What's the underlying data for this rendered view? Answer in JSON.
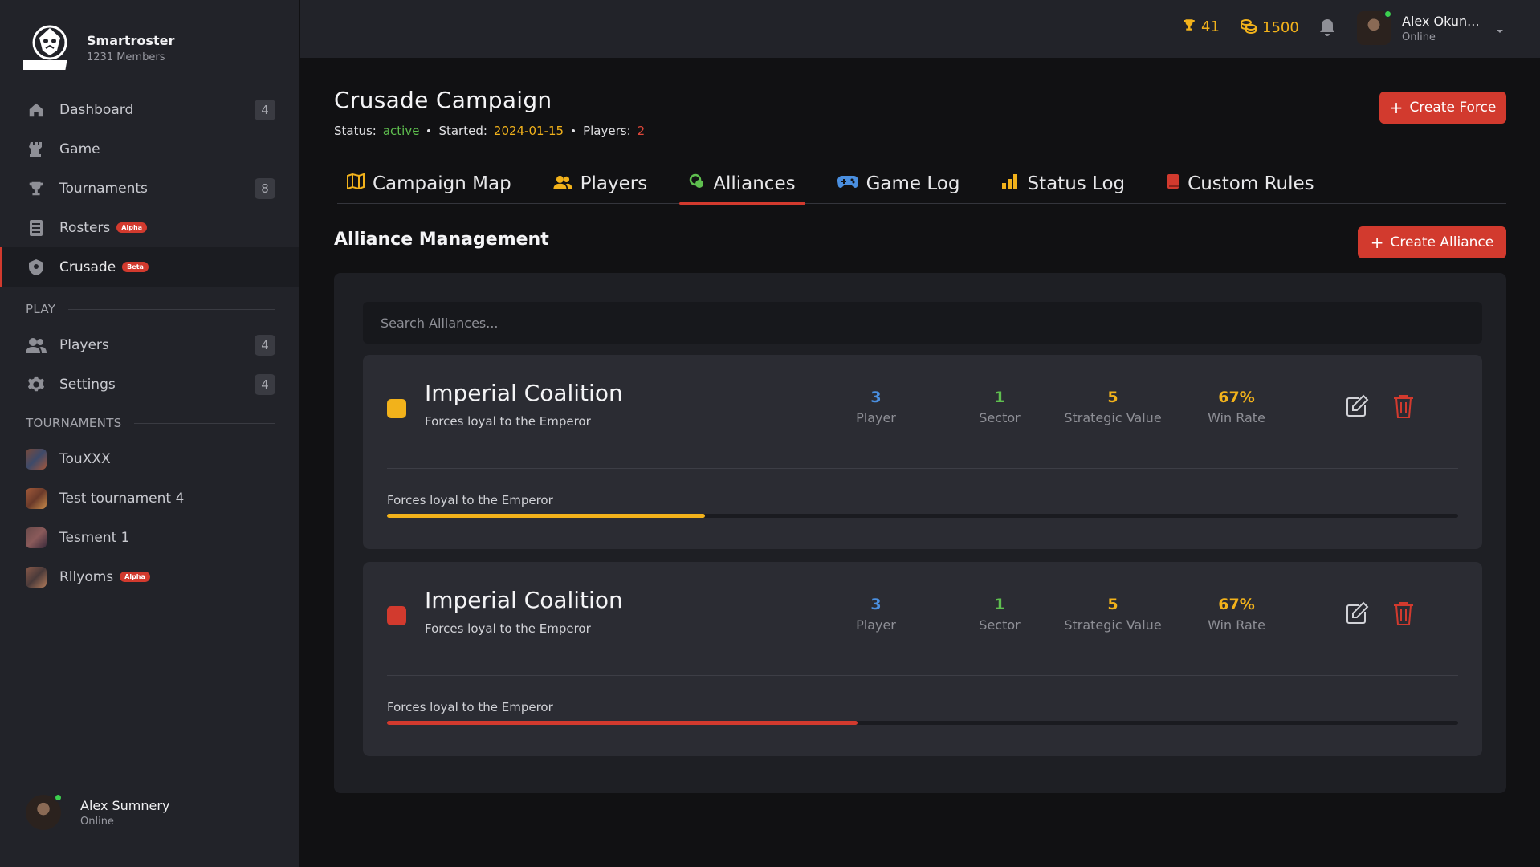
{
  "brand": {
    "name": "Smartroster",
    "members": "1231 Members",
    "logo_text": "SMARTROSTER"
  },
  "nav": [
    {
      "label": "Dashboard",
      "count": "4",
      "icon": "home-icon"
    },
    {
      "label": "Game",
      "count": "",
      "icon": "chess-rook-icon"
    },
    {
      "label": "Tournaments",
      "count": "8",
      "icon": "trophy-icon"
    },
    {
      "label": "Rosters",
      "badge": "Alpha",
      "icon": "list-icon"
    },
    {
      "label": "Crusade",
      "badge": "Beta",
      "icon": "shield-icon",
      "active": true
    }
  ],
  "play": {
    "title": "PLAY",
    "items": [
      {
        "label": "Players",
        "count": "4",
        "icon": "users-icon"
      },
      {
        "label": "Settings",
        "count": "4",
        "icon": "gear-icon"
      }
    ]
  },
  "tournaments": {
    "title": "TOURNAMENTS",
    "items": [
      {
        "label": "TouXXX"
      },
      {
        "label": "Test tournament 4"
      },
      {
        "label": "Tesment 1"
      },
      {
        "label": "Rllyoms",
        "badge": "Alpha"
      }
    ]
  },
  "sidebar_user": {
    "name": "Alex Sumnery",
    "status": "Online"
  },
  "topbar": {
    "trophies": "41",
    "coins": "1500",
    "user_name": "Alex Okun...",
    "user_status": "Online"
  },
  "campaign": {
    "title": "Crusade Campaign",
    "status_label": "Status:",
    "status": "active",
    "started_label": "Started:",
    "started": "2024-01-15",
    "players_label": "Players:",
    "players": "2",
    "create_force": "Create Force"
  },
  "tabs": [
    {
      "label": "Campaign Map",
      "icon": "map-icon",
      "color": "#f2b21b"
    },
    {
      "label": "Players",
      "icon": "users-icon",
      "color": "#f2b21b"
    },
    {
      "label": "Alliances",
      "icon": "alliance-icon",
      "color": "#5fbf4f",
      "active": true
    },
    {
      "label": "Game Log",
      "icon": "gamepad-icon",
      "color": "#4a8fe0"
    },
    {
      "label": "Status Log",
      "icon": "bar-chart-icon",
      "color": "#f2b21b"
    },
    {
      "label": "Custom Rules",
      "icon": "book-icon",
      "color": "#d23a2e"
    }
  ],
  "alliances": {
    "title": "Alliance Management",
    "create_label": "Create Alliance",
    "search_placeholder": "Search Alliances...",
    "items": [
      {
        "name": "Imperial Coalition",
        "desc": "Forces loyal to the Emperor",
        "color": "#f2b21b",
        "players": "3",
        "players_label": "Player",
        "sectors": "1",
        "sectors_label": "Sector",
        "strategic": "5",
        "strategic_label": "Strategic Value",
        "winrate": "67%",
        "winrate_label": "Win Rate",
        "progress_label": "Forces loyal to the Emperor",
        "progress": 0.297
      },
      {
        "name": "Imperial Coalition",
        "desc": "Forces loyal to the Emperor",
        "color": "#d23a2e",
        "players": "3",
        "players_label": "Player",
        "sectors": "1",
        "sectors_label": "Sector",
        "strategic": "5",
        "strategic_label": "Strategic Value",
        "winrate": "67%",
        "winrate_label": "Win Rate",
        "progress_label": "Forces loyal to the Emperor",
        "progress": 0.439
      }
    ]
  }
}
